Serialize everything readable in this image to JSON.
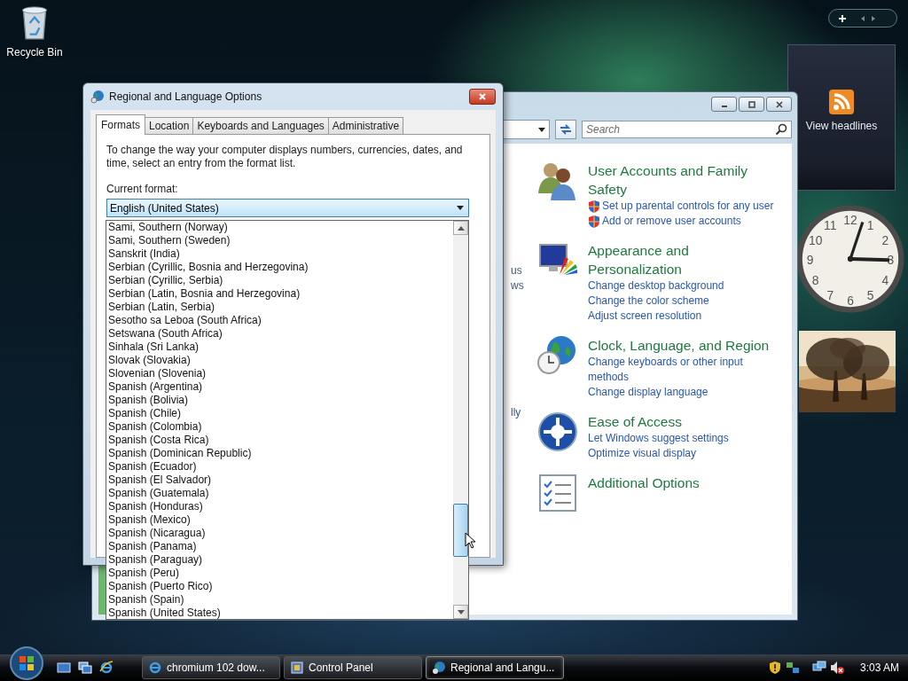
{
  "desktop": {
    "icons": [
      {
        "label": "Recycle Bin"
      }
    ]
  },
  "sidebar": {
    "feed_gadget": {
      "label": "View headlines"
    },
    "clock_gadget": {
      "numerals": [
        "11",
        "12",
        "1",
        "10",
        "2",
        "9",
        "3",
        "8",
        "4",
        "7",
        "6",
        "5"
      ]
    }
  },
  "control_panel": {
    "search": {
      "placeholder": "Search"
    },
    "nav_fragments": [
      "us",
      "ws",
      "lly"
    ],
    "categories": [
      {
        "kind": "users",
        "title": "User Accounts and Family Safety",
        "links": [
          {
            "text": "Set up parental controls for any user",
            "shield": true
          },
          {
            "text": "Add or remove user accounts",
            "shield": true
          }
        ]
      },
      {
        "kind": "appearance",
        "title": "Appearance and Personalization",
        "links": [
          {
            "text": "Change desktop background",
            "shield": false
          },
          {
            "text": "Change the color scheme",
            "shield": false
          },
          {
            "text": "Adjust screen resolution",
            "shield": false
          }
        ]
      },
      {
        "kind": "clock",
        "title": "Clock, Language, and Region",
        "links": [
          {
            "text": "Change keyboards or other input methods",
            "shield": false
          },
          {
            "text": "Change display language",
            "shield": false
          }
        ]
      },
      {
        "kind": "access",
        "title": "Ease of Access",
        "links": [
          {
            "text": "Let Windows suggest settings",
            "shield": false
          },
          {
            "text": "Optimize visual display",
            "shield": false
          }
        ]
      },
      {
        "kind": "options",
        "title": "Additional Options"
      }
    ]
  },
  "dialog": {
    "title": "Regional and Language Options",
    "tabs": [
      {
        "label": "Formats",
        "selected": true
      },
      {
        "label": "Location",
        "selected": false
      },
      {
        "label": "Keyboards and Languages",
        "selected": false
      },
      {
        "label": "Administrative",
        "selected": false
      }
    ],
    "description": "To change the way your computer displays numbers, currencies, dates, and time, select an entry from the format list.",
    "format_label": "Current format:",
    "format_combo": {
      "value": "English (United States)"
    },
    "dropdown": {
      "options": [
        "Sami, Southern (Norway)",
        "Sami, Southern (Sweden)",
        "Sanskrit (India)",
        "Serbian (Cyrillic, Bosnia and Herzegovina)",
        "Serbian (Cyrillic, Serbia)",
        "Serbian (Latin, Bosnia and Herzegovina)",
        "Serbian (Latin, Serbia)",
        "Sesotho sa Leboa (South Africa)",
        "Setswana (South Africa)",
        "Sinhala (Sri Lanka)",
        "Slovak (Slovakia)",
        "Slovenian (Slovenia)",
        "Spanish (Argentina)",
        "Spanish (Bolivia)",
        "Spanish (Chile)",
        "Spanish (Colombia)",
        "Spanish (Costa Rica)",
        "Spanish (Dominican Republic)",
        "Spanish (Ecuador)",
        "Spanish (El Salvador)",
        "Spanish (Guatemala)",
        "Spanish (Honduras)",
        "Spanish (Mexico)",
        "Spanish (Nicaragua)",
        "Spanish (Panama)",
        "Spanish (Paraguay)",
        "Spanish (Peru)",
        "Spanish (Puerto Rico)",
        "Spanish (Spain)",
        "Spanish (United States)"
      ]
    }
  },
  "taskbar": {
    "tasks": [
      {
        "kind": "browser",
        "label": "chromium 102 dow...",
        "selected": false
      },
      {
        "kind": "control",
        "label": "Control Panel",
        "selected": false
      },
      {
        "kind": "globe",
        "label": "Regional and Langu...",
        "selected": true
      }
    ],
    "clock": "3:03 AM"
  }
}
